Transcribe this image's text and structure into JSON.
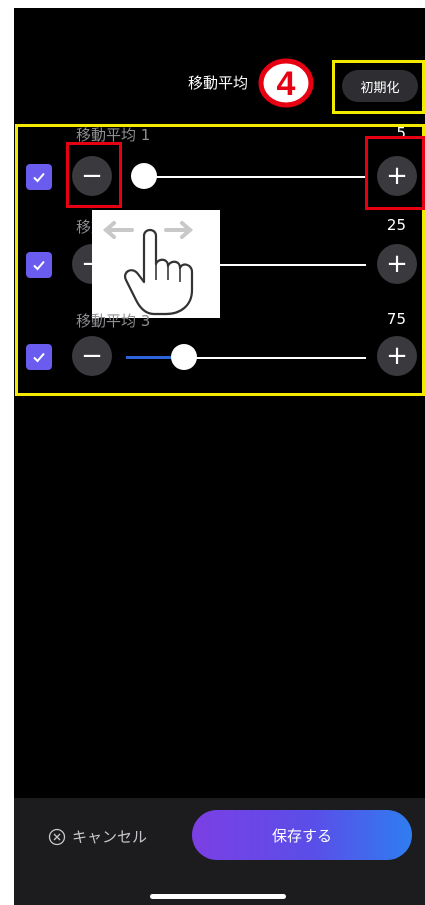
{
  "header": {
    "title": "移動平均",
    "step_number": "4",
    "reset_label": "初期化"
  },
  "rows": [
    {
      "label": "移動平均 1",
      "value": "5",
      "slider_fraction": 0.0
    },
    {
      "label": "移動平均 2",
      "value": "25",
      "slider_fraction": 0.0
    },
    {
      "label": "移動平均 3",
      "value": "75",
      "slider_fraction": 0.24
    }
  ],
  "buttons": {
    "minus": "−",
    "plus": "+"
  },
  "footer": {
    "cancel_label": "キャンセル",
    "save_label": "保存する"
  },
  "colors": {
    "checkbox": "#6b5cf0",
    "highlight_yellow": "#f4ea00",
    "highlight_red": "#e60012",
    "slider_fill": "#2f63d8"
  }
}
